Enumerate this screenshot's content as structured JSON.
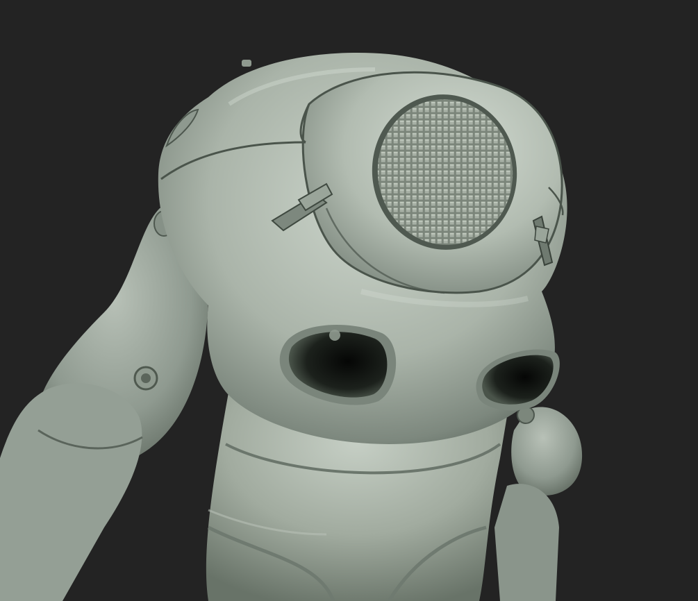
{
  "scene": {
    "subject": "robot-render",
    "colors": {
      "background": "#232323",
      "body_light": "#c9d2c8",
      "body_mid": "#9aa59a",
      "body_dark": "#5f6a60",
      "cavity": "#0e100e",
      "seam": "#4a544b"
    }
  }
}
